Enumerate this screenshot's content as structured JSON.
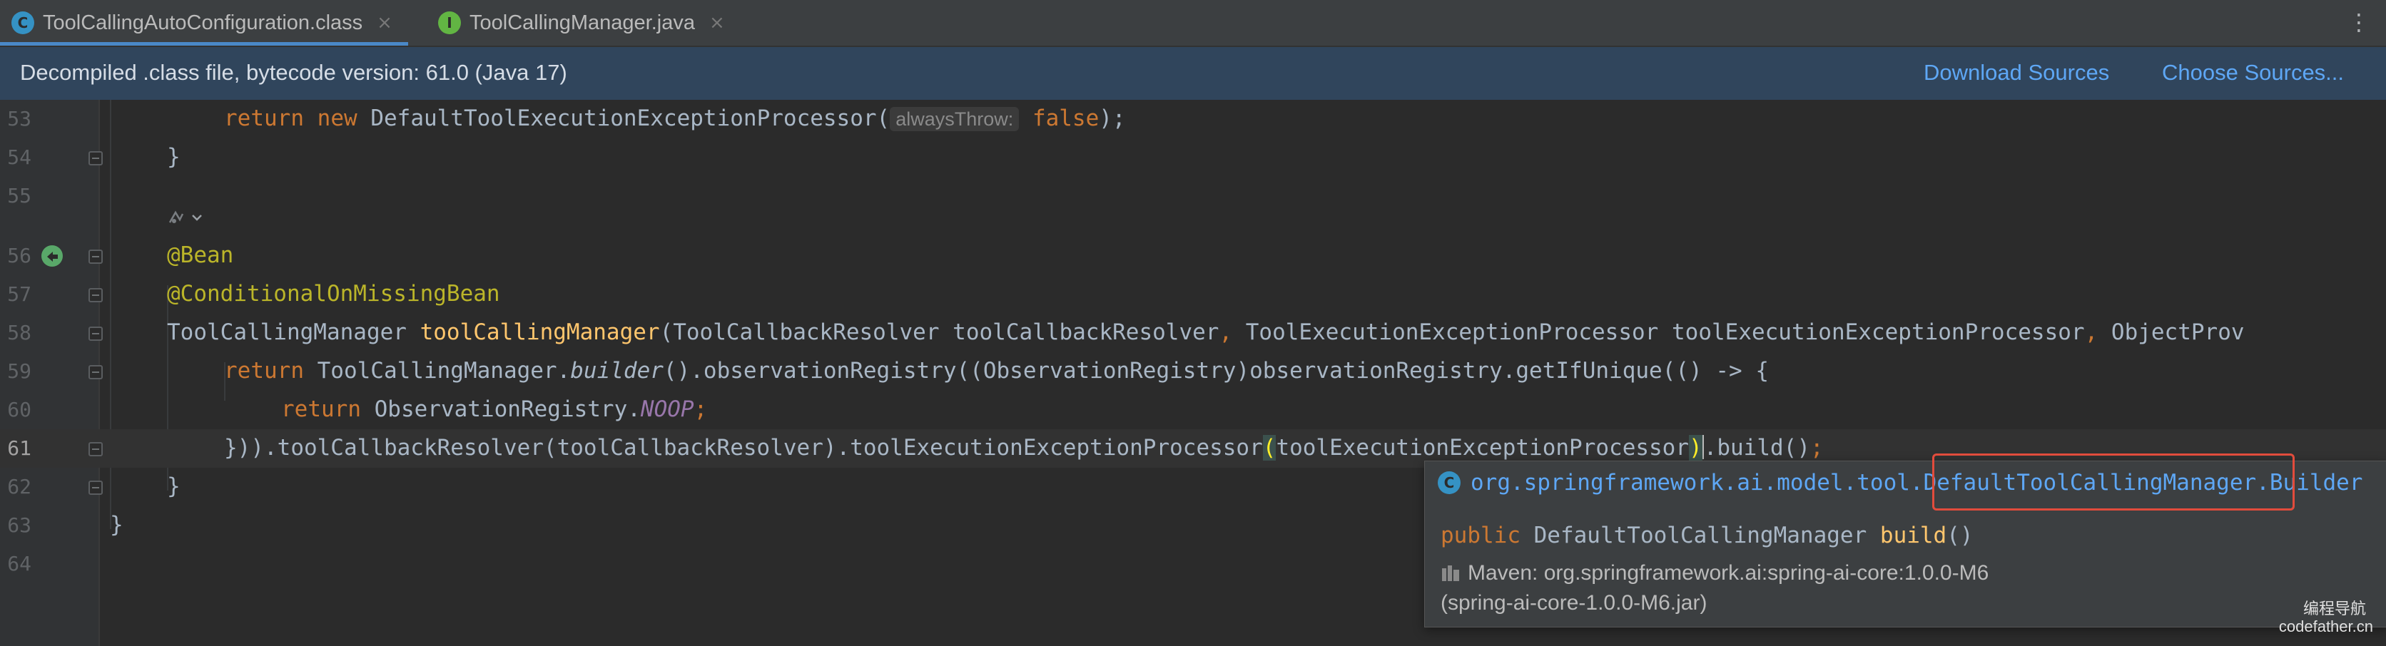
{
  "tabs": [
    {
      "label": "ToolCallingAutoConfiguration.class",
      "icon": "C",
      "icon_color": "#3592c4",
      "active": true
    },
    {
      "label": "ToolCallingManager.java",
      "icon": "I",
      "icon_color": "#62b543",
      "active": false
    }
  ],
  "tab_close_glyph": "×",
  "tab_more_glyph": "⋮",
  "banner": {
    "text": "Decompiled .class file, bytecode version: 61.0 (Java 17)",
    "download_sources": "Download Sources",
    "choose_sources": "Choose Sources..."
  },
  "lines": {
    "n53": "53",
    "n54": "54",
    "n55": "55",
    "n56": "56",
    "n57": "57",
    "n58": "58",
    "n59": "59",
    "n60": "60",
    "n61": "61",
    "n62": "62",
    "n63": "63",
    "n64": "64"
  },
  "code": {
    "l53_return": "return",
    "l53_new": "new",
    "l53_class": "DefaultToolExecutionExceptionProcessor(",
    "l53_hint": "alwaysThrow:",
    "l53_false": "false",
    "l53_end": ");",
    "l54": "}",
    "l56": "@Bean",
    "l57": "@ConditionalOnMissingBean",
    "l58_type": "ToolCallingManager ",
    "l58_method": "toolCallingManager",
    "l58_params": "(ToolCallbackResolver toolCallbackResolver",
    "l58_comma1": ", ",
    "l58_params2": "ToolExecutionExceptionProcessor toolExecutionExceptionProcessor",
    "l58_comma2": ", ",
    "l58_params3": "ObjectProv",
    "l59_return": "return",
    "l59_a": " ToolCallingManager.",
    "l59_builder": "builder",
    "l59_b": "().observationRegistry((ObservationRegistry)observationRegistry.getIfUnique(() -> {",
    "l60_return": "return",
    "l60_a": " ObservationRegistry.",
    "l60_noop": "NOOP",
    "l60_semi": ";",
    "l61_a": "})).toolCallbackResolver(toolCallbackResolver).toolExecutionExceptionProcessor",
    "l61_open": "(",
    "l61_b": "toolExecutionExceptionProcessor",
    "l61_close": ")",
    "l61_c": ".build()",
    "l61_semi": ";",
    "l62": "}",
    "l63": "}"
  },
  "popup": {
    "package": "org.springframework.ai.model.tool.",
    "class": "DefaultToolCallingManager",
    "dot": ".",
    "inner": "Builder",
    "sig_public": "public",
    "sig_type": " DefaultToolCallingManager ",
    "sig_method": "build",
    "sig_parens": "()",
    "maven": "Maven: org.springframework.ai:spring-ai-core:1.0.0-M6",
    "jar": "(spring-ai-core-1.0.0-M6.jar)"
  },
  "watermark": {
    "line1": "编程导航",
    "line2": "codefather.cn"
  }
}
